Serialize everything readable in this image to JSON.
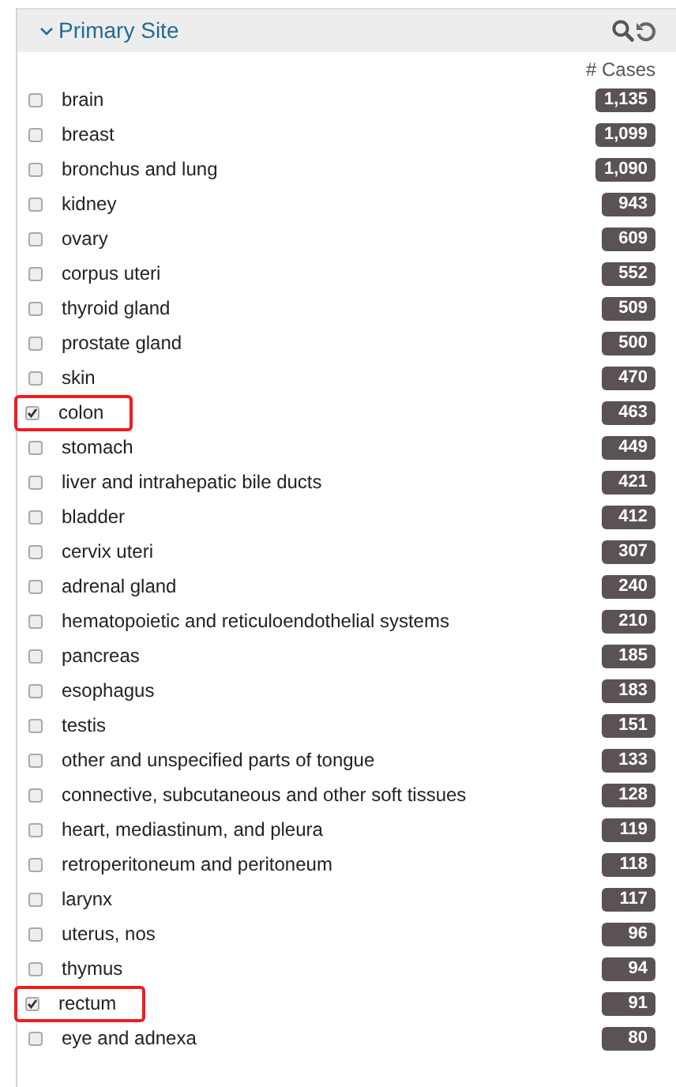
{
  "facet": {
    "title": "Primary Site",
    "expanded": true,
    "count_header": "# Cases",
    "items": [
      {
        "label": "brain",
        "count": "1,135",
        "checked": false
      },
      {
        "label": "breast",
        "count": "1,099",
        "checked": false
      },
      {
        "label": "bronchus and lung",
        "count": "1,090",
        "checked": false
      },
      {
        "label": "kidney",
        "count": "943",
        "checked": false
      },
      {
        "label": "ovary",
        "count": "609",
        "checked": false
      },
      {
        "label": "corpus uteri",
        "count": "552",
        "checked": false
      },
      {
        "label": "thyroid gland",
        "count": "509",
        "checked": false
      },
      {
        "label": "prostate gland",
        "count": "500",
        "checked": false
      },
      {
        "label": "skin",
        "count": "470",
        "checked": false
      },
      {
        "label": "colon",
        "count": "463",
        "checked": true
      },
      {
        "label": "stomach",
        "count": "449",
        "checked": false
      },
      {
        "label": "liver and intrahepatic bile ducts",
        "count": "421",
        "checked": false
      },
      {
        "label": "bladder",
        "count": "412",
        "checked": false
      },
      {
        "label": "cervix uteri",
        "count": "307",
        "checked": false
      },
      {
        "label": "adrenal gland",
        "count": "240",
        "checked": false
      },
      {
        "label": "hematopoietic and reticuloendothelial systems",
        "count": "210",
        "checked": false
      },
      {
        "label": "pancreas",
        "count": "185",
        "checked": false
      },
      {
        "label": "esophagus",
        "count": "183",
        "checked": false
      },
      {
        "label": "testis",
        "count": "151",
        "checked": false
      },
      {
        "label": "other and unspecified parts of tongue",
        "count": "133",
        "checked": false
      },
      {
        "label": "connective, subcutaneous and other soft tissues",
        "count": "128",
        "checked": false
      },
      {
        "label": "heart, mediastinum, and pleura",
        "count": "119",
        "checked": false
      },
      {
        "label": "retroperitoneum and peritoneum",
        "count": "118",
        "checked": false
      },
      {
        "label": "larynx",
        "count": "117",
        "checked": false
      },
      {
        "label": "uterus, nos",
        "count": "96",
        "checked": false
      },
      {
        "label": "thymus",
        "count": "94",
        "checked": false
      },
      {
        "label": "rectum",
        "count": "91",
        "checked": true
      },
      {
        "label": "eye and adnexa",
        "count": "80",
        "checked": false
      }
    ]
  }
}
